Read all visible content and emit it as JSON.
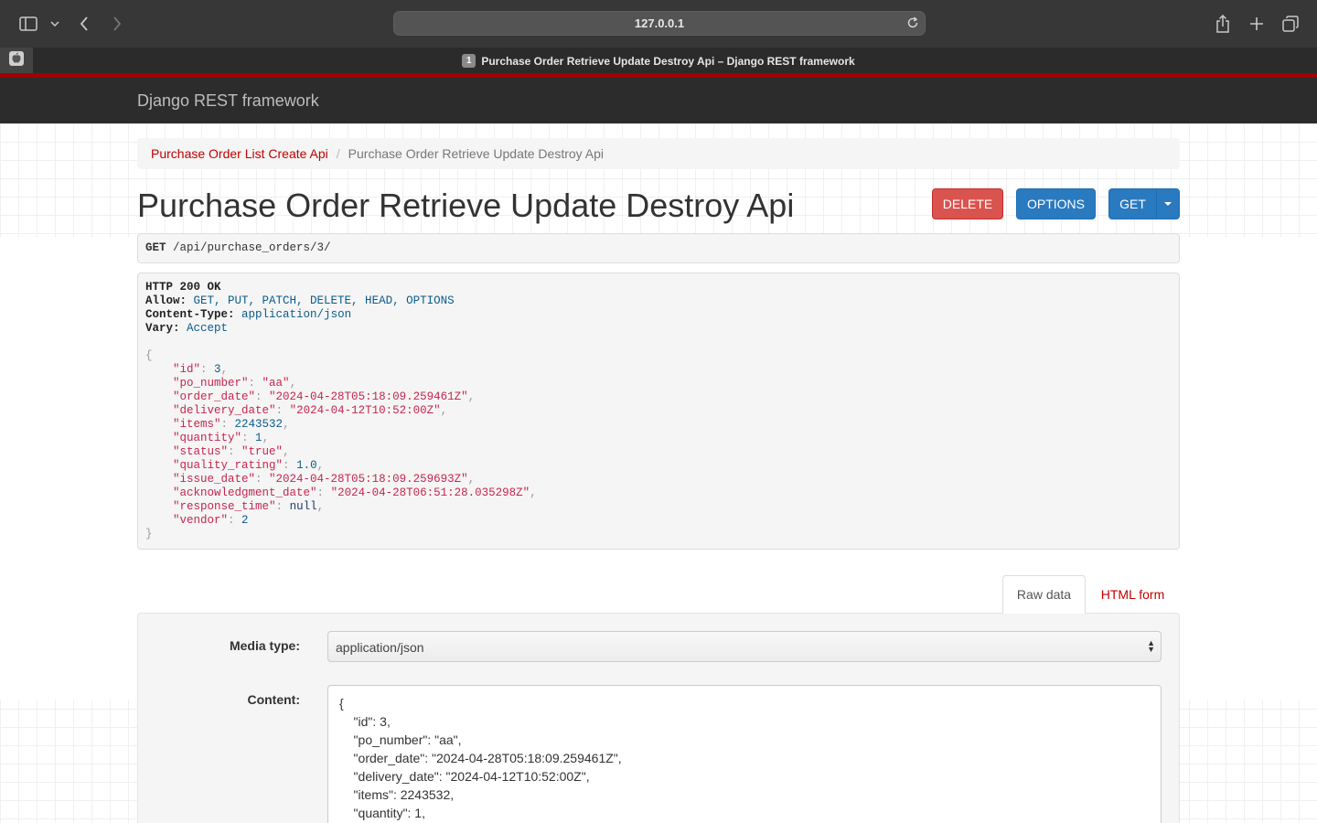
{
  "browser": {
    "url": "127.0.0.1",
    "tab_number": "1",
    "tab_title": "Purchase Order Retrieve Update Destroy Api – Django REST framework"
  },
  "navbar": {
    "brand": "Django REST framework"
  },
  "breadcrumb": {
    "link": "Purchase Order List Create Api",
    "separator": "/",
    "active": "Purchase Order Retrieve Update Destroy Api"
  },
  "page_title": "Purchase Order Retrieve Update Destroy Api",
  "buttons": {
    "delete": "DELETE",
    "options": "OPTIONS",
    "get": "GET"
  },
  "request": {
    "method": "GET",
    "path": "/api/purchase_orders/3/"
  },
  "response": {
    "status": "HTTP 200 OK",
    "headers": [
      {
        "name": "Allow:",
        "value": "GET, PUT, PATCH, DELETE, HEAD, OPTIONS"
      },
      {
        "name": "Content-Type:",
        "value": "application/json"
      },
      {
        "name": "Vary:",
        "value": "Accept"
      }
    ],
    "open_brace": "{",
    "close_brace": "}",
    "fields": [
      {
        "key": "\"id\"",
        "value": "3",
        "kind": "num",
        "comma": ","
      },
      {
        "key": "\"po_number\"",
        "value": "\"aa\"",
        "kind": "str",
        "comma": ","
      },
      {
        "key": "\"order_date\"",
        "value": "\"2024-04-28T05:18:09.259461Z\"",
        "kind": "str",
        "comma": ","
      },
      {
        "key": "\"delivery_date\"",
        "value": "\"2024-04-12T10:52:00Z\"",
        "kind": "str",
        "comma": ","
      },
      {
        "key": "\"items\"",
        "value": "2243532",
        "kind": "num",
        "comma": ","
      },
      {
        "key": "\"quantity\"",
        "value": "1",
        "kind": "num",
        "comma": ","
      },
      {
        "key": "\"status\"",
        "value": "\"true\"",
        "kind": "str",
        "comma": ","
      },
      {
        "key": "\"quality_rating\"",
        "value": "1.0",
        "kind": "num",
        "comma": ","
      },
      {
        "key": "\"issue_date\"",
        "value": "\"2024-04-28T05:18:09.259693Z\"",
        "kind": "str",
        "comma": ","
      },
      {
        "key": "\"acknowledgment_date\"",
        "value": "\"2024-04-28T06:51:28.035298Z\"",
        "kind": "str",
        "comma": ","
      },
      {
        "key": "\"response_time\"",
        "value": "null",
        "kind": "null",
        "comma": ","
      },
      {
        "key": "\"vendor\"",
        "value": "2",
        "kind": "num",
        "comma": ""
      }
    ]
  },
  "form_tabs": {
    "raw": "Raw data",
    "html": "HTML form"
  },
  "form": {
    "media_label": "Media type:",
    "media_value": "application/json",
    "content_label": "Content:",
    "content_lines": [
      "{",
      "    \"id\": 3,",
      "    \"po_number\": \"aa\",",
      "    \"order_date\": \"2024-04-28T05:18:09.259461Z\",",
      "    \"delivery_date\": \"2024-04-12T10:52:00Z\",",
      "    \"items\": 2243532,",
      "    \"quantity\": 1,"
    ]
  },
  "colors": {
    "accent_red": "#c20000",
    "btn_blue": "#2a7ac0",
    "btn_red": "#d9534f"
  }
}
